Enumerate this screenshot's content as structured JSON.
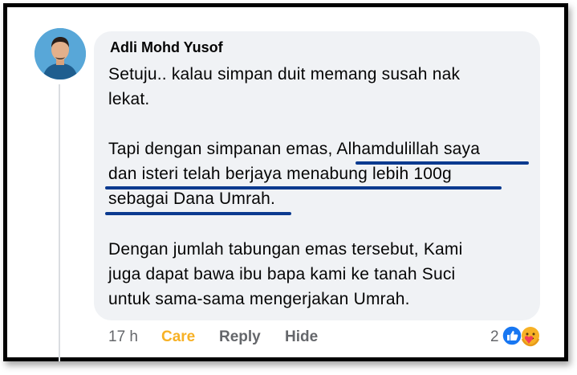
{
  "comment": {
    "author": "Adli Mohd Yusof",
    "paragraphs": [
      [
        "Setuju.. kalau simpan duit memang susah nak",
        "lekat."
      ],
      [
        "Tapi dengan simpanan emas, Alhamdulillah saya",
        "dan isteri telah berjaya menabung lebih 100g",
        "sebagai Dana Umrah."
      ],
      [
        "Dengan jumlah tabungan emas tersebut, Kami",
        "juga dapat bawa ibu bapa kami ke tanah Suci",
        "untuk sama-sama mengerjakan Umrah."
      ]
    ],
    "highlight_color": "#0b3a8f"
  },
  "actions": {
    "time": "17 h",
    "care": "Care",
    "reply": "Reply",
    "hide": "Hide",
    "care_color": "#f7b125"
  },
  "reactions": {
    "count": "2",
    "icons": [
      "like-icon",
      "care-icon"
    ]
  }
}
